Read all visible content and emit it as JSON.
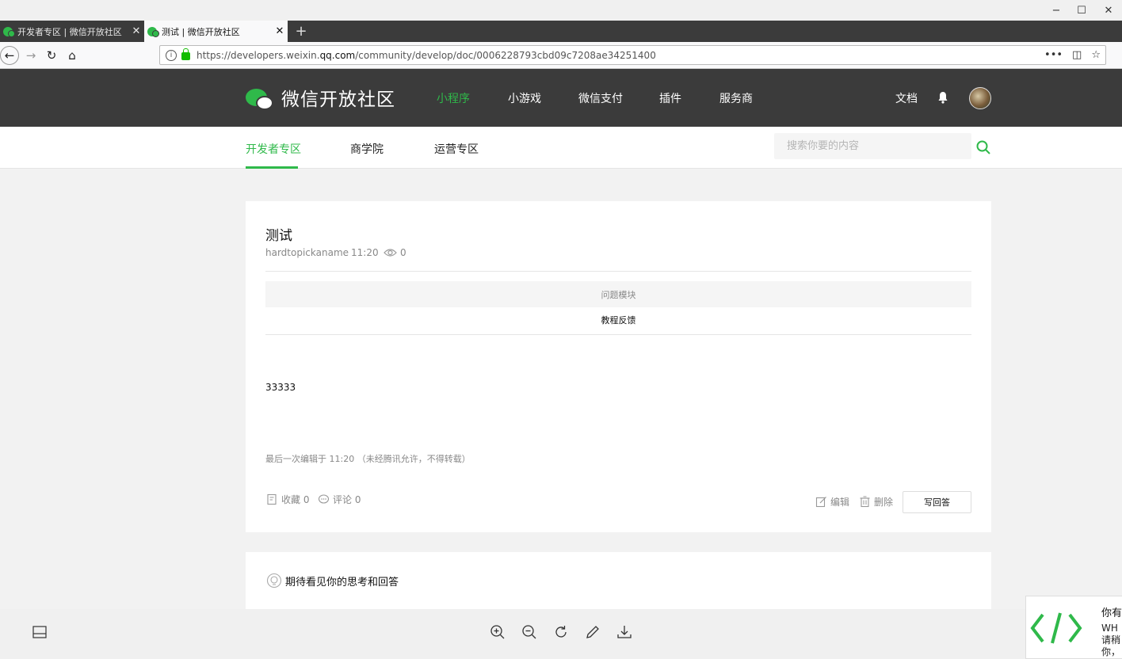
{
  "window": {
    "minimize": "−",
    "maximize": "☐",
    "close": "✕"
  },
  "tabs": [
    {
      "title": "开发者专区 | 微信开放社区",
      "close": "✕"
    },
    {
      "title": "测试 | 微信开放社区",
      "close": "✕"
    }
  ],
  "new_tab": "+",
  "browser": {
    "back": "←",
    "forward": "→",
    "reload": "↻",
    "home": "⌂",
    "info": "i",
    "url_prefix": "https://developers.weixin.",
    "url_domain": "qq.com",
    "url_suffix": "/community/develop/doc/0006228793cbd09c7208ae34251400",
    "more": "•••",
    "pocket": "◫",
    "star": "☆"
  },
  "site": {
    "name": "微信开放社区",
    "nav": [
      "小程序",
      "小游戏",
      "微信支付",
      "插件",
      "服务商"
    ],
    "docs": "文档",
    "bell": "🔔"
  },
  "subnav": {
    "items": [
      "开发者专区",
      "商学院",
      "运营专区"
    ],
    "search_placeholder": "搜索你要的内容"
  },
  "post": {
    "title": "测试",
    "author": "hardtopickaname",
    "time": "11:20",
    "views": "0",
    "module_header": "问题模块",
    "module_value": "教程反馈",
    "content": "33333",
    "last_edit": "最后一次编辑于  11:20    （未经腾讯允许，不得转载）",
    "collect": "收藏 0",
    "comment": "评论 0",
    "edit": "编辑",
    "delete": "删除",
    "write_answer": "写回答"
  },
  "prompt": "期待看见你的思考和回答",
  "panel": {
    "title": "你有",
    "text": "WH 请稍 你，"
  },
  "colors": {
    "accent": "#2fb94a",
    "header_bg": "#3b3b3b"
  }
}
